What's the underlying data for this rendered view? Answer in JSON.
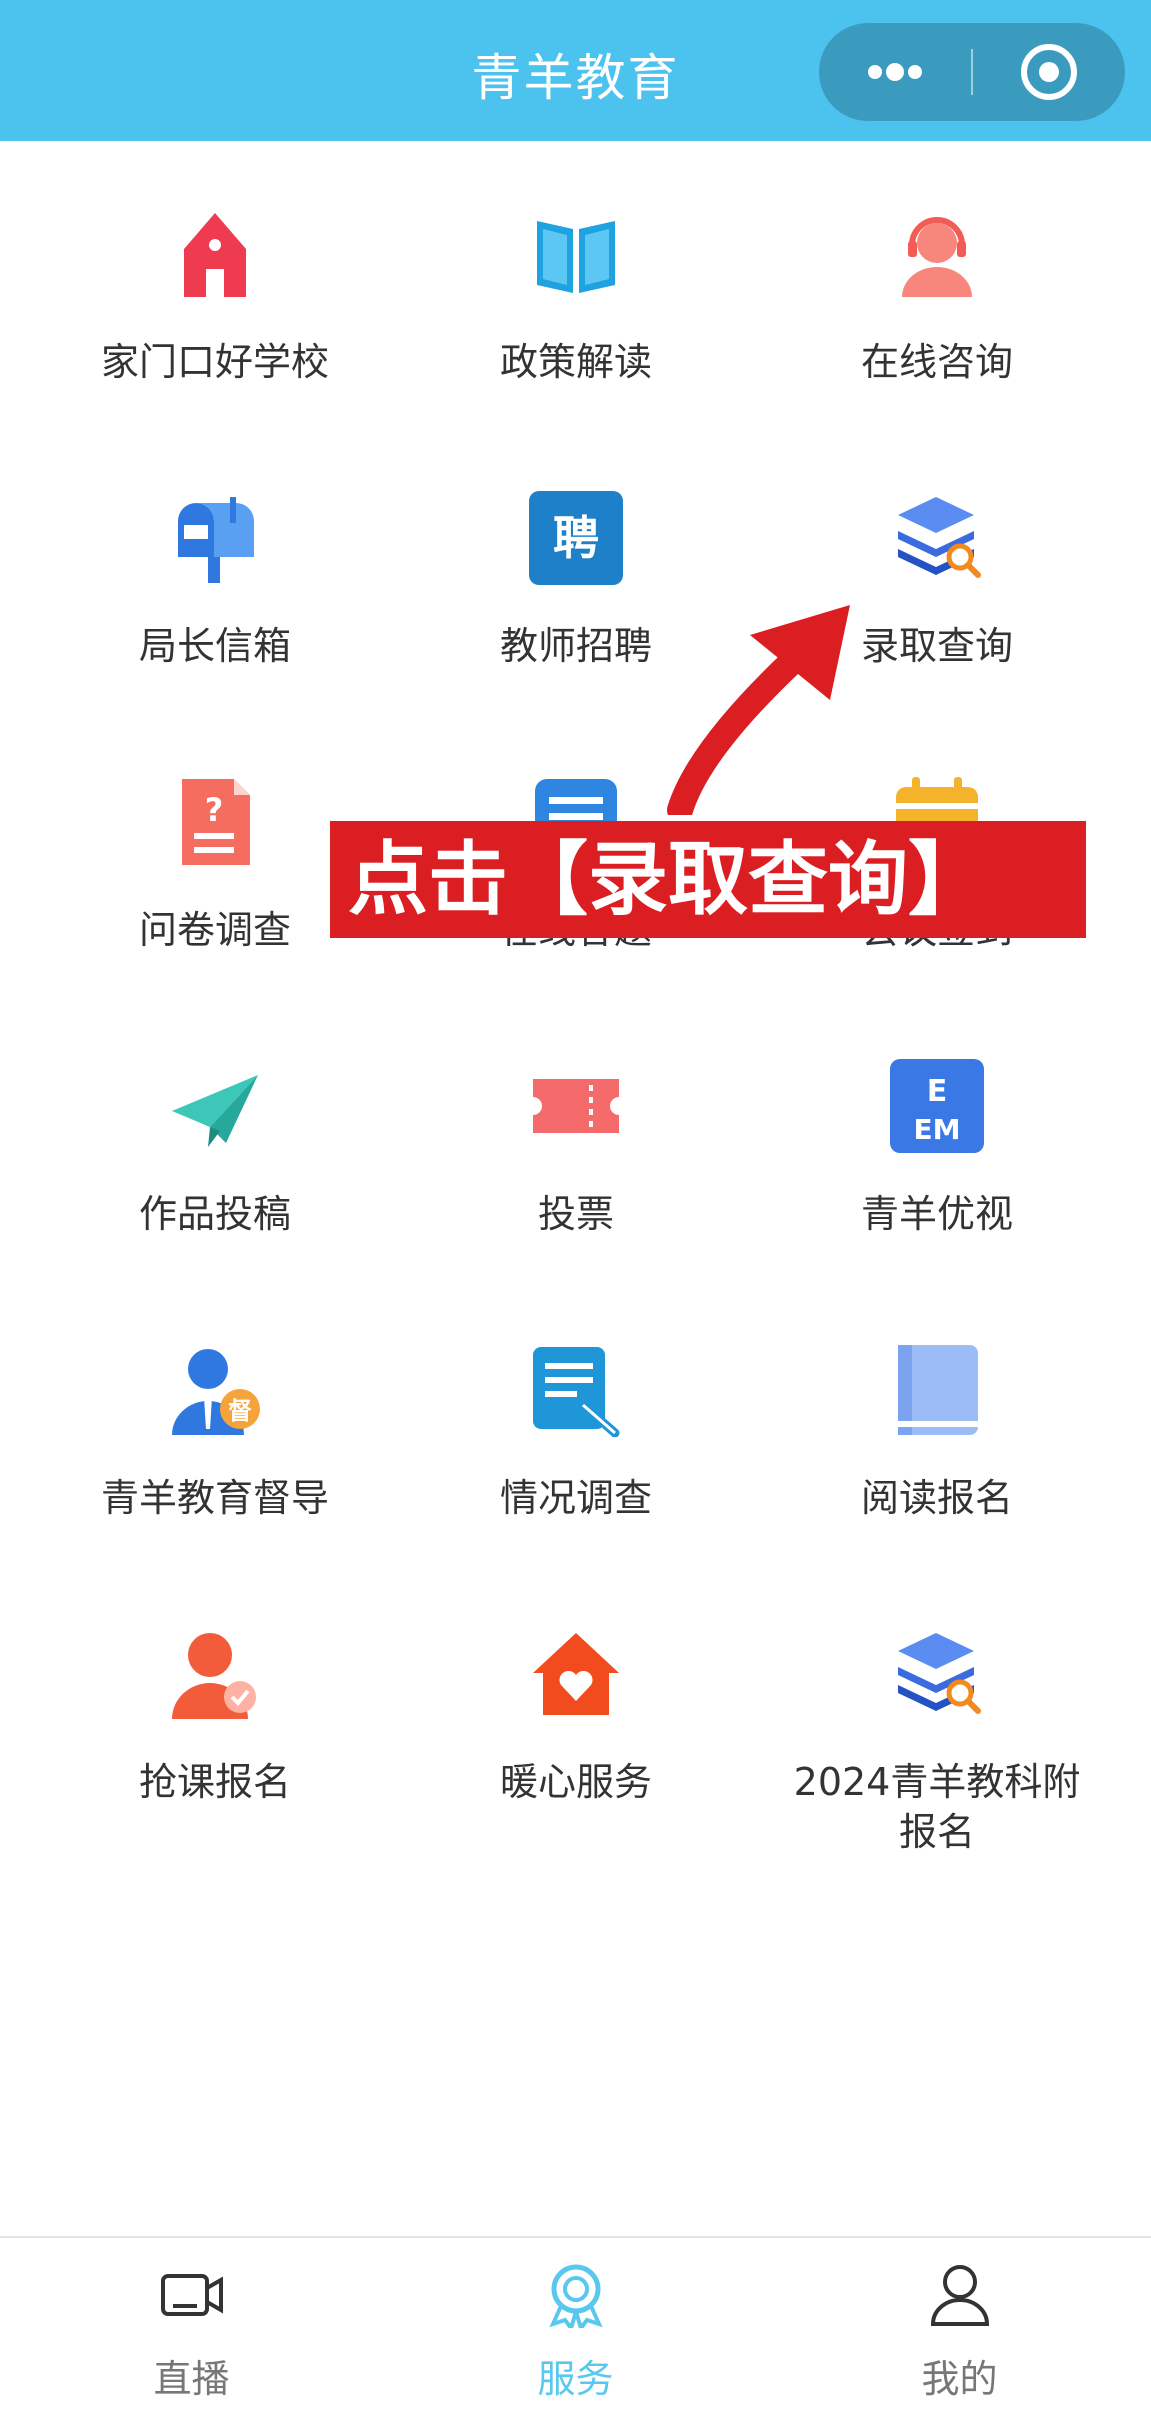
{
  "header": {
    "title": "青羊教育"
  },
  "grid": {
    "items": [
      {
        "label": "家门口好学校"
      },
      {
        "label": "政策解读"
      },
      {
        "label": "在线咨询"
      },
      {
        "label": "局长信箱"
      },
      {
        "label": "教师招聘"
      },
      {
        "label": "录取查询"
      },
      {
        "label": "问卷调查"
      },
      {
        "label": "在线答题"
      },
      {
        "label": "会议签到"
      },
      {
        "label": "作品投稿"
      },
      {
        "label": "投票"
      },
      {
        "label": "青羊优视"
      },
      {
        "label": "青羊教育督导"
      },
      {
        "label": "情况调查"
      },
      {
        "label": "阅读报名"
      },
      {
        "label": "抢课报名"
      },
      {
        "label": "暖心服务"
      },
      {
        "label": "2024青羊教科附报名"
      }
    ]
  },
  "icon_glyphs": {
    "recruit": "聘",
    "supervision": "督"
  },
  "annotation": {
    "text": "点击【录取查询】",
    "color": "#db1e22"
  },
  "tabbar": {
    "items": [
      {
        "label": "直播",
        "icon": "video-camera-icon"
      },
      {
        "label": "服务",
        "icon": "service-badge-icon",
        "active": true
      },
      {
        "label": "我的",
        "icon": "user-icon"
      }
    ]
  },
  "colors": {
    "header": "#4cc2ee",
    "active_tab": "#59c8ee"
  }
}
